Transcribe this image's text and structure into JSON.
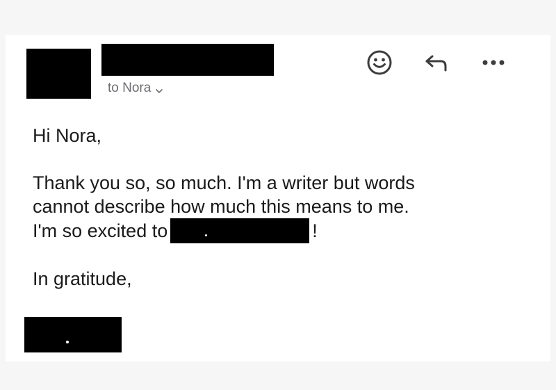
{
  "header": {
    "recipient_label": "to Nora"
  },
  "icons": {
    "emoji": "smiley-icon",
    "reply": "reply-arrow-icon",
    "more": "more-dots-icon",
    "recipient_toggle": "chevron-down-icon"
  },
  "message": {
    "greeting": "Hi Nora,",
    "line1": "Thank you so, so much. I'm a writer but words",
    "line2": "cannot describe how much this means to me.",
    "line3_before": "I'm so excited to",
    "line3_after": "!",
    "closing": "In gratitude,"
  }
}
